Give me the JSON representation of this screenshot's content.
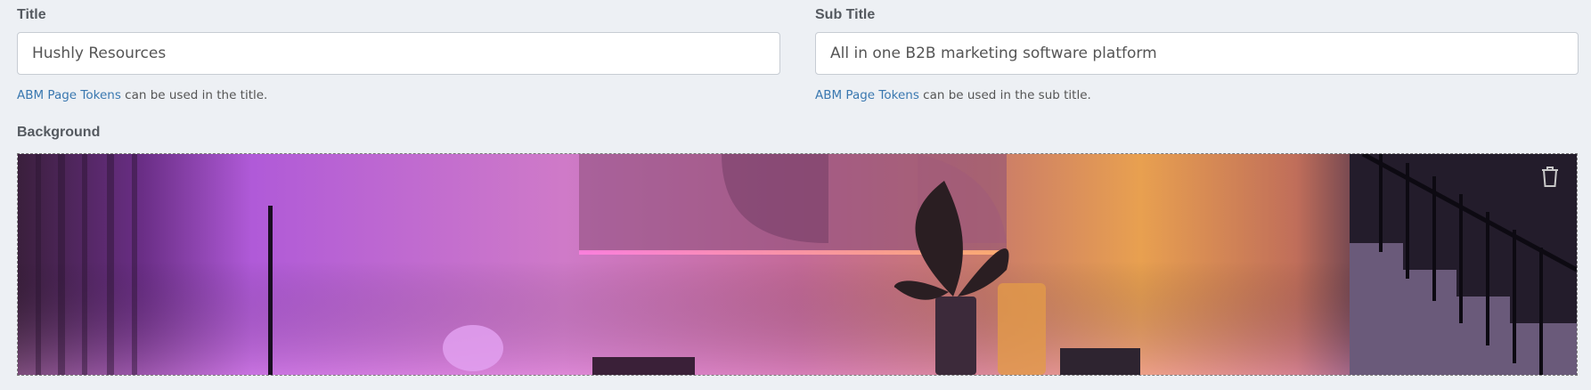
{
  "title_field": {
    "label": "Title",
    "value": "Hushly Resources",
    "help_link": "ABM Page Tokens",
    "help_text": " can be used in the title."
  },
  "subtitle_field": {
    "label": "Sub Title",
    "value": "All in one B2B marketing software platform",
    "help_link": "ABM Page Tokens",
    "help_text": " can be used in the sub title."
  },
  "background": {
    "label": "Background",
    "image": "interior-room-gradient-lighting-photo",
    "delete_icon": "trash-icon"
  }
}
